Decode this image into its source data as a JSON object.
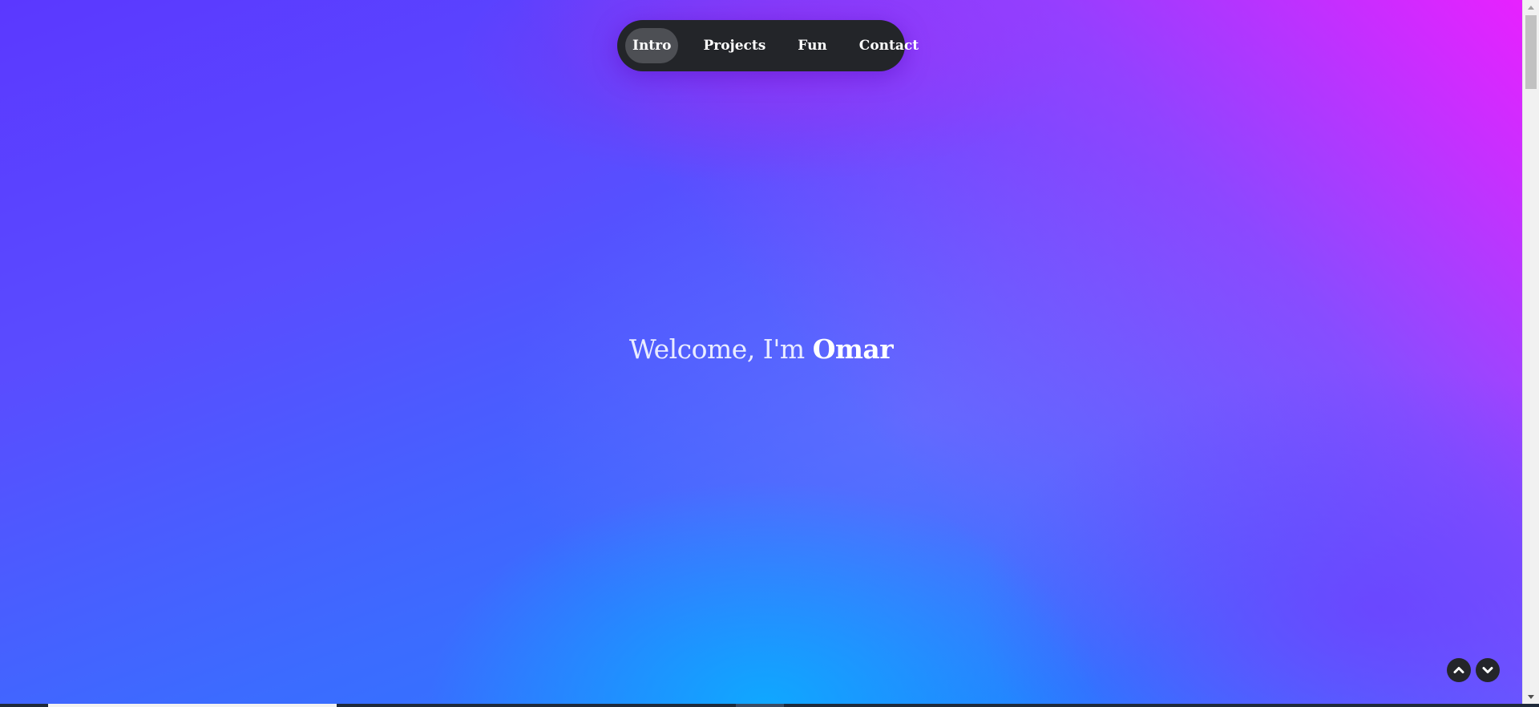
{
  "nav": {
    "items": [
      {
        "label": "Intro",
        "active": true
      },
      {
        "label": "Projects",
        "active": false
      },
      {
        "label": "Fun",
        "active": false
      },
      {
        "label": "Contact",
        "active": false
      }
    ]
  },
  "hero": {
    "greeting": "Welcome, I'm",
    "name": "Omar"
  },
  "controls": {
    "up_icon": "chevron-up-icon",
    "down_icon": "chevron-down-icon"
  },
  "colors": {
    "nav_bg": "#232529",
    "nav_active": "#4d4f54",
    "bg_top_left": "#5b38ff",
    "bg_top_right": "#f01eff",
    "bg_bottom": "#0eaaff"
  }
}
